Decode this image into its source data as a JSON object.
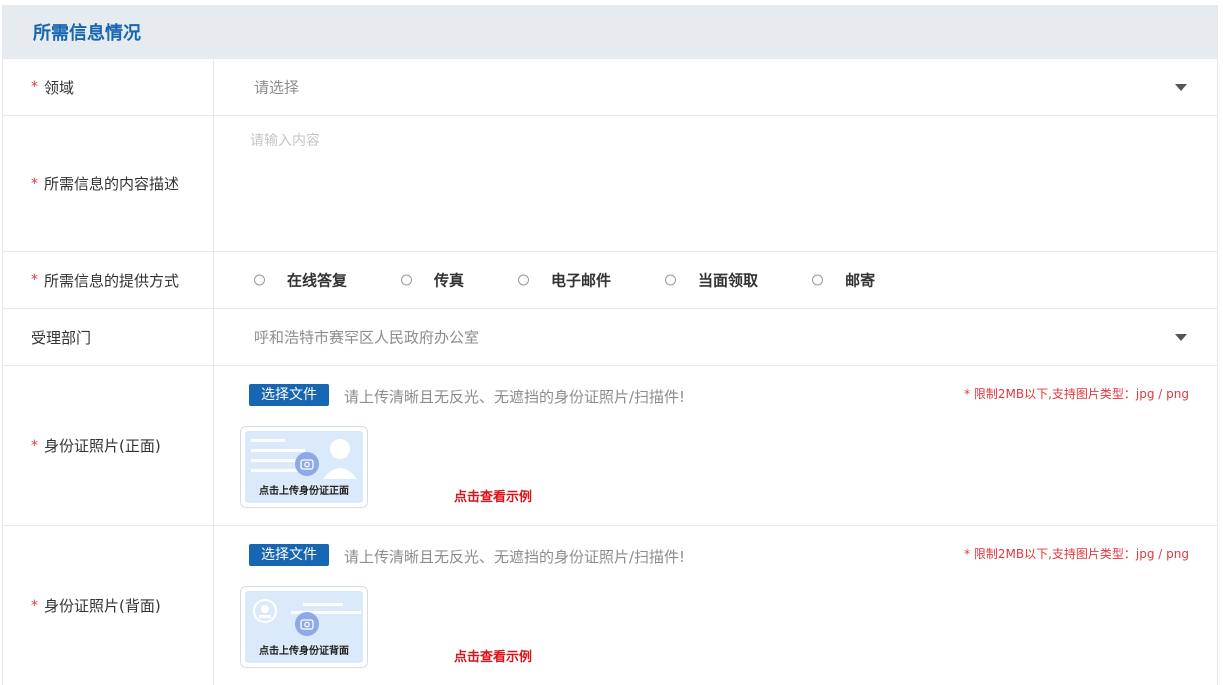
{
  "header": {
    "title": "所需信息情况"
  },
  "required_mark": "*",
  "field": {
    "label": "领域",
    "placeholder": "请选择"
  },
  "description": {
    "label": "所需信息的内容描述",
    "placeholder": "请输入内容"
  },
  "method": {
    "label": "所需信息的提供方式",
    "options": [
      "在线答复",
      "传真",
      "电子邮件",
      "当面领取",
      "邮寄"
    ]
  },
  "department": {
    "label": "受理部门",
    "value": "呼和浩特市赛罕区人民政府办公室"
  },
  "id_front": {
    "label": "身份证照片(正面)",
    "button": "选择文件",
    "hint": "请上传清晰且无反光、无遮挡的身份证照片/扫描件!",
    "limit": "* 限制2MB以下,支持图片类型：jpg / png",
    "card_caption": "点击上传身份证正面",
    "example_link": "点击查看示例"
  },
  "id_back": {
    "label": "身份证照片(背面)",
    "button": "选择文件",
    "hint": "请上传清晰且无反光、无遮挡的身份证照片/扫描件!",
    "limit": "* 限制2MB以下,支持图片类型：jpg / png",
    "card_caption": "点击上传身份证背面",
    "example_link": "点击查看示例"
  },
  "colors": {
    "accent": "#1766b1",
    "required": "#e0383e",
    "header_bg": "#e6ebf0",
    "link": "#d8131a"
  }
}
